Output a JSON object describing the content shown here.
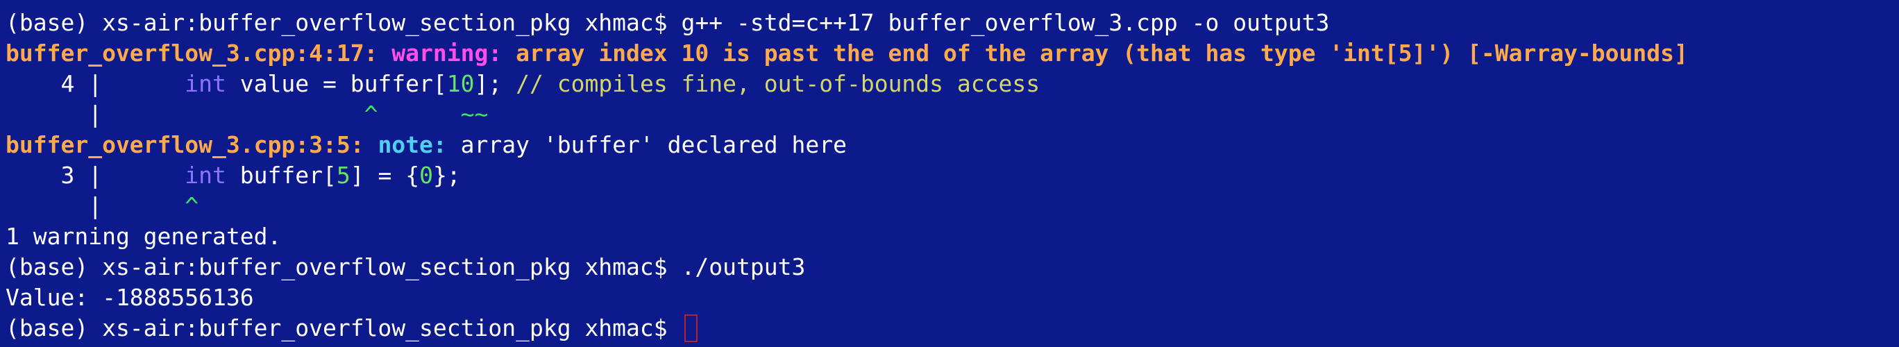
{
  "terminal": {
    "background": "#0d1a8c",
    "lines": {
      "l1": {
        "prompt": "(base) xs-air:buffer_overflow_section_pkg xhmac$ ",
        "command": "g++ -std=c++17 buffer_overflow_3.cpp -o output3"
      },
      "l2": {
        "loc": "buffer_overflow_3.cpp:4:17: ",
        "kind": "warning:",
        "message": " array index 10 is past the end of the array (that has type 'int[5]') [-Warray-bounds]"
      },
      "l3": {
        "gutter": "    4 |      ",
        "kw": "int",
        "pre": " value = buffer[",
        "num": "10",
        "post": "]; ",
        "comment": "// compiles fine, out-of-bounds access"
      },
      "l4": {
        "gutter": "      |                   ",
        "caret": "^",
        "gap": "      ",
        "tilde": "~~"
      },
      "l5": {
        "loc": "buffer_overflow_3.cpp:3:5: ",
        "kind": "note:",
        "message": " array 'buffer' declared here"
      },
      "l6": {
        "gutter": "    3 |      ",
        "kw": "int",
        "pre": " buffer[",
        "num1": "5",
        "mid": "] = {",
        "num2": "0",
        "post": "};"
      },
      "l7": {
        "gutter": "      |      ",
        "caret": "^"
      },
      "l8": {
        "text": "1 warning generated."
      },
      "l9": {
        "prompt": "(base) xs-air:buffer_overflow_section_pkg xhmac$ ",
        "command": "./output3"
      },
      "l10": {
        "text": "Value: -1888556136"
      },
      "l11": {
        "prompt": "(base) xs-air:buffer_overflow_section_pkg xhmac$ "
      }
    }
  }
}
